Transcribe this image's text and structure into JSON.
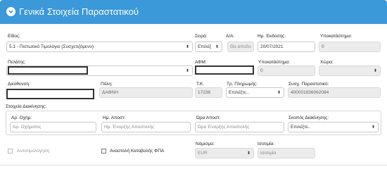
{
  "header": {
    "title": "Γενικά Στοιχεία Παραστατικού"
  },
  "labels": {
    "eidos": "Είδος:",
    "seira": "Σειρά:",
    "aa": "Α/Α:",
    "hm_ekdosis": "Ημ. Έκδοσης:",
    "ypokatastima1": "Υποκατάστημα:",
    "pelatis": "Πελάτης:",
    "afm": "ΑΦΜ:",
    "ypokatastima2": "Υποκατάστημα:",
    "xora": "Χώρα:",
    "dieythinsi": "Διεύθυνση:",
    "poli": "Πόλη:",
    "tk": "Τ.Κ.",
    "tr_pliromis": "Τρ. Πληρωμής:",
    "sysx_parastatiko": "Συσχ. Παραστατικό:",
    "stoixeia_diakinisis": "Στοιχεία Διακίνησης:",
    "ar_oximatos": "Αρ. Οχήμ:",
    "hm_apostolis": "Ημ. Αποστ:",
    "ora_apostolis": "Ώρα Αποστ:",
    "skopos": "Σκοπός Διακίνησης:",
    "nomisma": "Νόμισμα:",
    "isotimia": "Ισοτιμία:"
  },
  "fields": {
    "eidos": "5.1 - Πιστωτικό Τιμολόγιο (Συσχετιζόμενο)",
    "seira": "Επιλέξ",
    "aa": "Θα αποδο",
    "hm_ekdosis": "20/07/2021",
    "ypokatastima1": "0",
    "pelatis": "",
    "afm": "",
    "ypokatastima2": "0",
    "xora": "",
    "dieythinsi": "",
    "poli": "ΔΑΦΝΗ",
    "tk": "17236",
    "tr_pliromis": "Επιλέξτε..",
    "sysx_parastatiko": "400001836062084",
    "ar_oximatos_placeholder": "Αρ. Οχήματος",
    "hm_apostolis_placeholder": "Ημ. Έναρξης Αποστολής",
    "ora_apostolis_placeholder": "Ώρα Έναρξης Αποστολής",
    "skopos": "Επιλέξτε..",
    "nomisma": "EUR",
    "isotimia_placeholder": "Ισοτιμία"
  },
  "checkboxes": {
    "autotimologisi": "Αυτοτιμολόγηση",
    "anastoli_fpa": "Αναστολή Καταβολής ΦΠΑ"
  },
  "colors": {
    "header": "#3b98d9",
    "readonly": "#ececec"
  }
}
